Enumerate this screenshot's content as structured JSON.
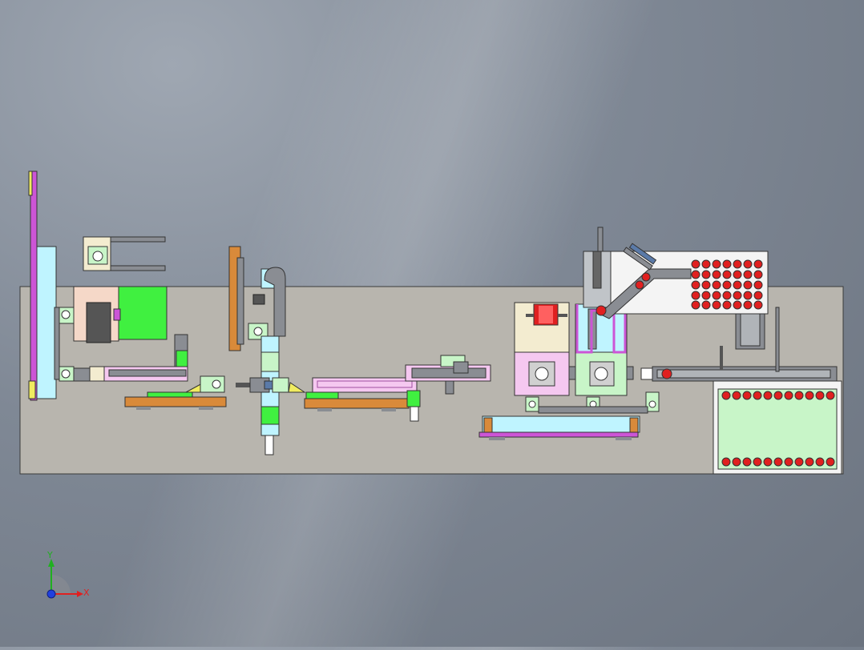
{
  "viewport": {
    "background_top": "#6f7784",
    "background_bottom": "#b8bec8"
  },
  "machine": {
    "base_color": "#b8b5ae",
    "outline_color": "#3a3a3a",
    "accent_colors": {
      "cyan": "#bff4ff",
      "magenta": "#cc55d6",
      "green": "#40f040",
      "light_green": "#c8f5c8",
      "pink": "#f5c8f0",
      "orange": "#d98a3a",
      "red": "#e02020",
      "beige": "#f3ecd0",
      "yellow": "#f0ec60",
      "gray": "#8a8d93",
      "blue": "#5a7aa8"
    }
  },
  "triad": {
    "x_label": "X",
    "y_label": "Y",
    "x_color": "#e02020",
    "y_color": "#20b020",
    "z_color": "#2040e0"
  }
}
